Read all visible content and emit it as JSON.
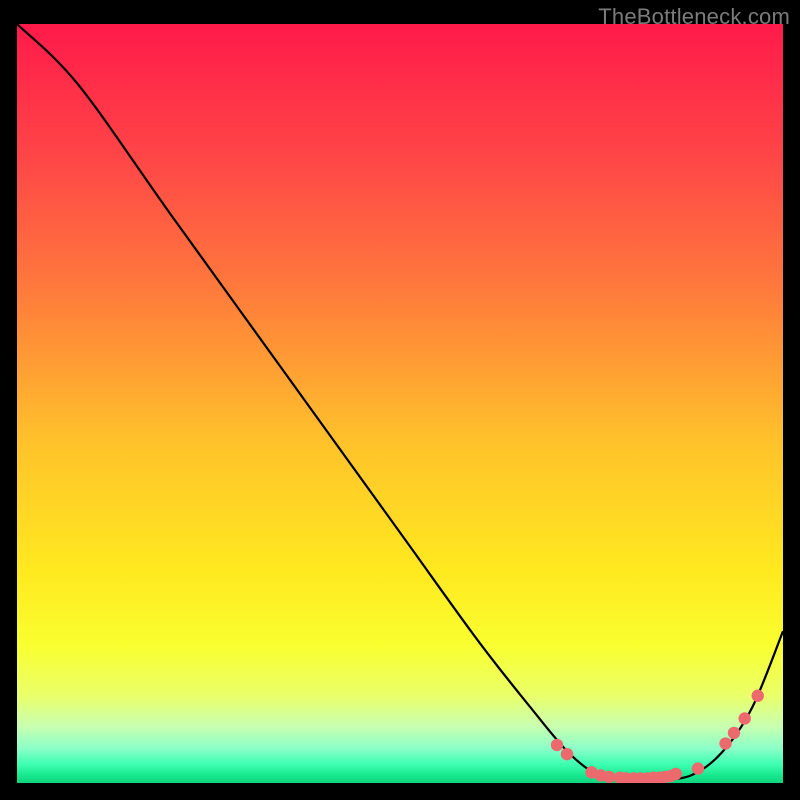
{
  "watermark": "TheBottleneck.com",
  "colors": {
    "black": "#000000",
    "line": "#000000",
    "dot": "#ec6a6e",
    "watermark": "#7b7b7b",
    "gradient_stops": [
      {
        "offset": 0.0,
        "color": "#ff1a4a"
      },
      {
        "offset": 0.18,
        "color": "#ff4747"
      },
      {
        "offset": 0.35,
        "color": "#ff7a3c"
      },
      {
        "offset": 0.55,
        "color": "#ffc22b"
      },
      {
        "offset": 0.72,
        "color": "#ffe91f"
      },
      {
        "offset": 0.82,
        "color": "#f9ff30"
      },
      {
        "offset": 0.885,
        "color": "#eaff6a"
      },
      {
        "offset": 0.925,
        "color": "#c9ffb0"
      },
      {
        "offset": 0.955,
        "color": "#8affc8"
      },
      {
        "offset": 0.975,
        "color": "#3fffb2"
      },
      {
        "offset": 0.99,
        "color": "#17e88e"
      },
      {
        "offset": 1.0,
        "color": "#0fd47d"
      }
    ]
  },
  "chart_data": {
    "type": "line",
    "title": "",
    "xlabel": "",
    "ylabel": "",
    "xlim": [
      0,
      100
    ],
    "ylim": [
      0,
      100
    ],
    "series": [
      {
        "name": "curve",
        "x": [
          0,
          8,
          20,
          35,
          50,
          60,
          67,
          72,
          76,
          80,
          84,
          88,
          92,
          96,
          100
        ],
        "y": [
          100,
          92,
          75,
          54,
          33,
          19,
          10,
          4,
          1,
          0.5,
          0.5,
          1,
          4,
          10,
          20
        ]
      }
    ],
    "scatter": {
      "name": "dots",
      "points": [
        {
          "x": 70.5,
          "y": 5.0
        },
        {
          "x": 71.8,
          "y": 3.8
        },
        {
          "x": 75.0,
          "y": 1.4
        },
        {
          "x": 76.2,
          "y": 1.0
        },
        {
          "x": 77.3,
          "y": 0.8
        },
        {
          "x": 78.7,
          "y": 0.7
        },
        {
          "x": 79.5,
          "y": 0.6
        },
        {
          "x": 80.5,
          "y": 0.6
        },
        {
          "x": 81.4,
          "y": 0.6
        },
        {
          "x": 82.3,
          "y": 0.6
        },
        {
          "x": 83.1,
          "y": 0.7
        },
        {
          "x": 83.9,
          "y": 0.7
        },
        {
          "x": 84.6,
          "y": 0.8
        },
        {
          "x": 85.3,
          "y": 0.9
        },
        {
          "x": 86.0,
          "y": 1.2
        },
        {
          "x": 88.9,
          "y": 1.9
        },
        {
          "x": 92.5,
          "y": 5.2
        },
        {
          "x": 93.6,
          "y": 6.6
        },
        {
          "x": 95.0,
          "y": 8.5
        },
        {
          "x": 96.7,
          "y": 11.5
        }
      ]
    }
  }
}
